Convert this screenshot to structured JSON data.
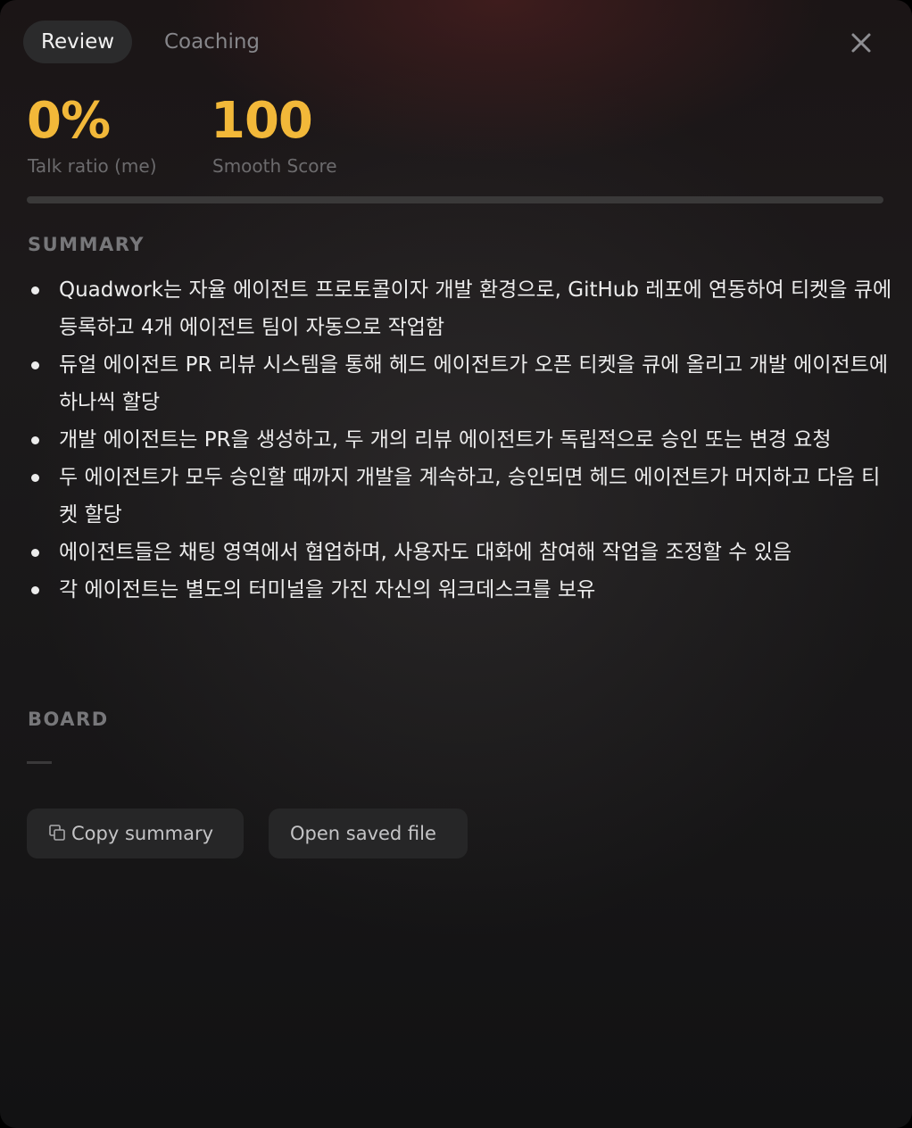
{
  "tabs": [
    {
      "label": "Review",
      "active": true
    },
    {
      "label": "Coaching",
      "active": false
    }
  ],
  "close_icon": "close-icon",
  "stats": {
    "talk_ratio": {
      "value": "0%",
      "label": "Talk ratio (me)"
    },
    "smooth_score": {
      "value": "100",
      "label": "Smooth Score"
    }
  },
  "talk_ratio_bar": {
    "fraction": 0.0
  },
  "summary": {
    "heading": "SUMMARY",
    "items": [
      "Quadwork는 자율 에이전트 프로토콜이자 개발 환경으로, GitHub 레포에 연동하여 티켓을 큐에 등록하고 4개 에이전트 팀이 자동으로 작업함",
      "듀얼 에이전트 PR 리뷰 시스템을 통해 헤드 에이전트가 오픈 티켓을 큐에 올리고 개발 에이전트에 하나씩 할당",
      "개발 에이전트는 PR을 생성하고, 두 개의 리뷰 에이전트가 독립적으로 승인 또는 변경 요청",
      "두 에이전트가 모두 승인할 때까지 개발을 계속하고, 승인되면 헤드 에이전트가 머지하고 다음 티켓 할당",
      "에이전트들은 채팅 영역에서 협업하며, 사용자도 대화에 참여해 작업을 조정할 수 있음",
      "각 에이전트는 별도의 터미널을 가진 자신의 워크데스크를 보유"
    ]
  },
  "board": {
    "heading": "BOARD"
  },
  "buttons": {
    "copy_summary": "Copy summary",
    "open_saved_file": "Open saved file"
  },
  "colors": {
    "accent": "#f2b839",
    "text": "#ececec",
    "muted": "#77777a",
    "button_bg": "#262627"
  }
}
